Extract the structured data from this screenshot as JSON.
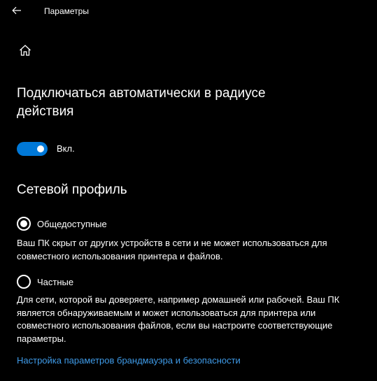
{
  "window": {
    "title": "Параметры"
  },
  "icons": {
    "back": "back-arrow-icon",
    "home": "home-icon"
  },
  "auto_connect": {
    "heading": "Подключаться автоматически в радиусе действия",
    "toggle_state": true,
    "toggle_label": "Вкл."
  },
  "network_profile": {
    "heading": "Сетевой профиль",
    "options": [
      {
        "label": "Общедоступные",
        "selected": true,
        "description": "Ваш ПК скрыт от других устройств в сети и не может использоваться для совместного использования принтера и файлов."
      },
      {
        "label": "Частные",
        "selected": false,
        "description": "Для сети, которой вы доверяете, например домашней или рабочей. Ваш ПК является обнаруживаемым и может использоваться для принтера или совместного использования файлов, если вы настроите соответствующие параметры."
      }
    ]
  },
  "firewall_link": "Настройка параметров брандмауэра и безопасности",
  "colors": {
    "background": "#000000",
    "accent": "#0078d7",
    "link": "#3f9be8",
    "text": "#ffffff"
  }
}
